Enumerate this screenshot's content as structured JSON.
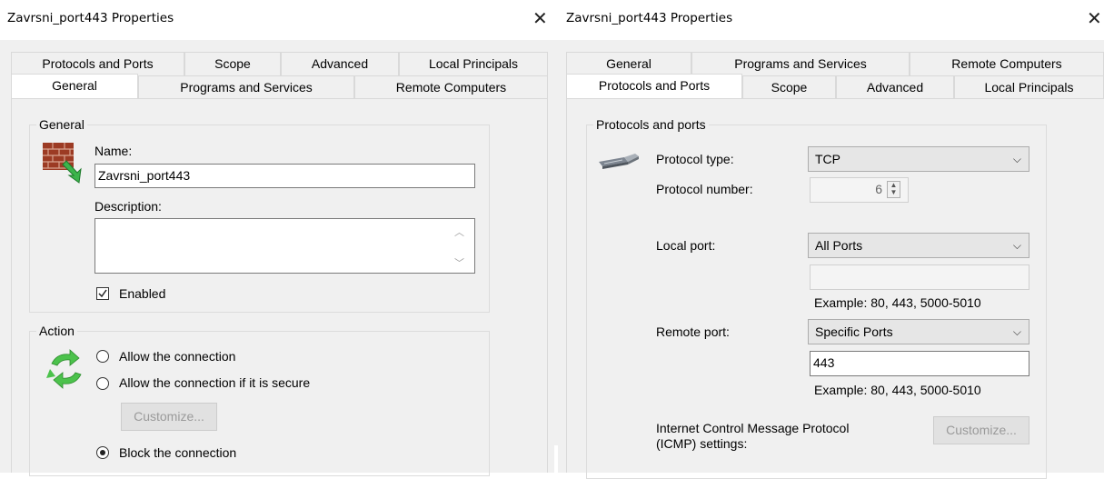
{
  "left": {
    "title": "Zavrsni_port443 Properties",
    "close_glyph": "✕",
    "tabs_row1": [
      "Protocols and Ports",
      "Scope",
      "Advanced",
      "Local Principals"
    ],
    "tabs_row2": [
      "General",
      "Programs and Services",
      "Remote Computers"
    ],
    "general_group": {
      "label": "General",
      "name_label": "Name:",
      "name_value": "Zavrsni_port443",
      "description_label": "Description:",
      "description_value": "",
      "enabled_label": "Enabled",
      "enabled_checked": true,
      "icon": "firewall-rule-icon"
    },
    "action_group": {
      "label": "Action",
      "icon": "refresh-arrows-icon",
      "options": [
        "Allow the connection",
        "Allow the connection if it is secure",
        "Block the connection"
      ],
      "selected": "Block the connection",
      "customize_label": "Customize..."
    }
  },
  "right": {
    "title": "Zavrsni_port443 Properties",
    "close_glyph": "✕",
    "tabs_row1": [
      "General",
      "Programs and Services",
      "Remote Computers"
    ],
    "tabs_row2": [
      "Protocols and Ports",
      "Scope",
      "Advanced",
      "Local Principals"
    ],
    "group_label": "Protocols and ports",
    "icon": "network-cable-icon",
    "protocol_type_label": "Protocol type:",
    "protocol_type_value": "TCP",
    "protocol_number_label": "Protocol number:",
    "protocol_number_value": "6",
    "local_port_label": "Local port:",
    "local_port_value": "All Ports",
    "local_port_text": "",
    "example_local": "Example: 80, 443, 5000-5010",
    "remote_port_label": "Remote port:",
    "remote_port_value": "Specific Ports",
    "remote_port_text": "443",
    "example_remote": "Example: 80, 443, 5000-5010",
    "icmp_label_line1": "Internet Control Message Protocol",
    "icmp_label_line2": "(ICMP) settings:",
    "customize_label": "Customize..."
  },
  "colors": {
    "panel": "#f0f0f0",
    "disabled_text": "#9a9a9a"
  }
}
